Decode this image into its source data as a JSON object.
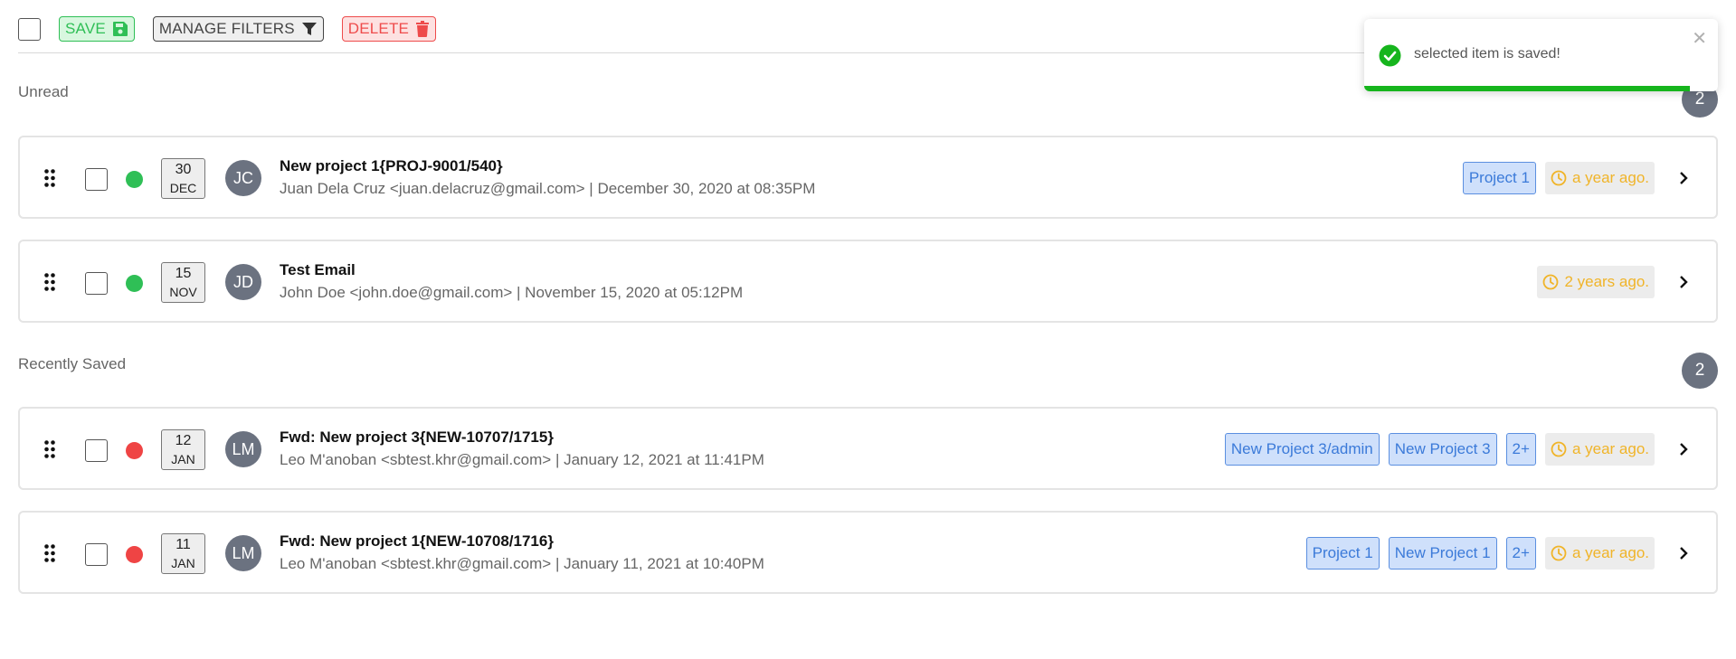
{
  "toolbar": {
    "save_label": "SAVE",
    "filters_label": "MANAGE FILTERS",
    "delete_label": "DELETE"
  },
  "colors": {
    "save": "#2fbf56",
    "delete": "#ee4b4b",
    "tag": "#3b7ad9",
    "time": "#f0b429",
    "badge": "#6b7280",
    "toast_progress": "#16b51d"
  },
  "sections": [
    {
      "label": "Unread",
      "count": "2",
      "items": [
        {
          "day": "30",
          "month": "DEC",
          "initials": "JC",
          "status": "green",
          "subject": "New project 1{PROJ-9001/540}",
          "meta": "Juan Dela Cruz <juan.delacruz@gmail.com> | December 30, 2020 at 08:35PM",
          "tags": [
            "Project 1"
          ],
          "time": "a year ago."
        },
        {
          "day": "15",
          "month": "NOV",
          "initials": "JD",
          "status": "green",
          "subject": "Test Email",
          "meta": "John Doe <john.doe@gmail.com> | November 15, 2020 at 05:12PM",
          "tags": [],
          "time": "2 years ago."
        }
      ]
    },
    {
      "label": "Recently Saved",
      "count": "2",
      "items": [
        {
          "day": "12",
          "month": "JAN",
          "initials": "LM",
          "status": "red",
          "subject": "Fwd: New project 3{NEW-10707/1715}",
          "meta": "Leo M'anoban <sbtest.khr@gmail.com> | January 12, 2021 at 11:41PM",
          "tags": [
            "New Project 3/admin",
            "New Project 3",
            "2+"
          ],
          "time": "a year ago."
        },
        {
          "day": "11",
          "month": "JAN",
          "initials": "LM",
          "status": "red",
          "subject": "Fwd: New project 1{NEW-10708/1716}",
          "meta": "Leo M'anoban <sbtest.khr@gmail.com> | January 11, 2021 at 10:40PM",
          "tags": [
            "Project 1",
            "New Project 1",
            "2+"
          ],
          "time": "a year ago."
        }
      ]
    }
  ],
  "toast": {
    "message": "selected item is saved!",
    "close_icon": "close-icon",
    "progress": 0.92
  }
}
